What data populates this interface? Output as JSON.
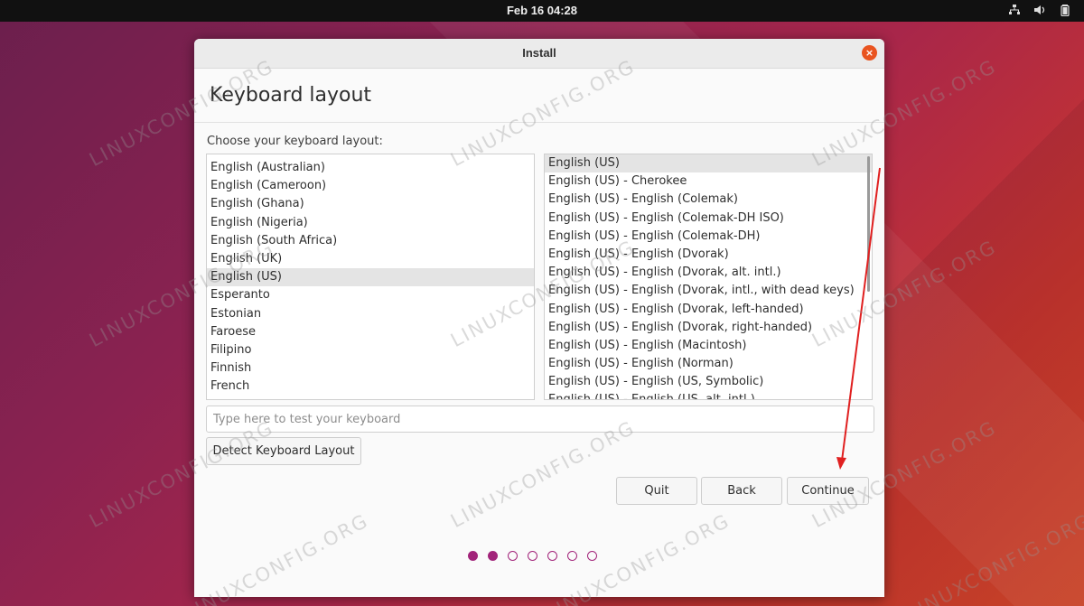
{
  "topbar": {
    "datetime": "Feb 16  04:28",
    "icons": [
      "network-icon",
      "volume-icon",
      "battery-icon"
    ]
  },
  "window": {
    "title": "Install",
    "close_glyph": "×"
  },
  "page": {
    "heading": "Keyboard layout",
    "prompt": "Choose your keyboard layout:"
  },
  "layouts": {
    "items": [
      "English (Australian)",
      "English (Cameroon)",
      "English (Ghana)",
      "English (Nigeria)",
      "English (South Africa)",
      "English (UK)",
      "English (US)",
      "Esperanto",
      "Estonian",
      "Faroese",
      "Filipino",
      "Finnish",
      "French"
    ],
    "selected": "English (US)"
  },
  "variants": {
    "items": [
      "English (US)",
      "English (US) - Cherokee",
      "English (US) - English (Colemak)",
      "English (US) - English (Colemak-DH ISO)",
      "English (US) - English (Colemak-DH)",
      "English (US) - English (Dvorak)",
      "English (US) - English (Dvorak, alt. intl.)",
      "English (US) - English (Dvorak, intl., with dead keys)",
      "English (US) - English (Dvorak, left-handed)",
      "English (US) - English (Dvorak, right-handed)",
      "English (US) - English (Macintosh)",
      "English (US) - English (Norman)",
      "English (US) - English (US, Symbolic)",
      "English (US) - English (US, alt. intl.)"
    ],
    "selected": "English (US)"
  },
  "test_field": {
    "placeholder": "Type here to test your keyboard",
    "value": ""
  },
  "buttons": {
    "detect": "Detect Keyboard Layout",
    "quit": "Quit",
    "back": "Back",
    "continue": "Continue"
  },
  "progress": {
    "total_steps": 7,
    "completed_steps": 2
  },
  "watermark": "LINUXCONFIG.ORG",
  "colors": {
    "accent": "#a2247a",
    "close": "#e95420",
    "arrow": "#e02020"
  }
}
